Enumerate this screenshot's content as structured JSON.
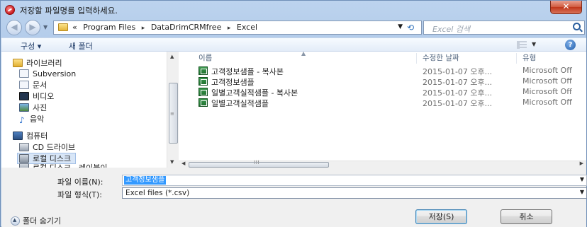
{
  "window": {
    "title": "저장할 파일명를 입력하세요.",
    "close_glyph": "✕"
  },
  "address": {
    "crumbs": [
      "«",
      "Program Files",
      "DataDrimCRMfree",
      "Excel"
    ],
    "separator": "▸",
    "search_placeholder": "Excel 검색"
  },
  "toolbar": {
    "organize": "구성 ▾",
    "new_folder": "새 폴더",
    "help_glyph": "?"
  },
  "nav": {
    "items": [
      {
        "label": "라이브러리",
        "icon": "library-icon"
      },
      {
        "label": "Subversion",
        "icon": "document-icon"
      },
      {
        "label": "문서",
        "icon": "document-icon"
      },
      {
        "label": "비디오",
        "icon": "video-icon"
      },
      {
        "label": "사진",
        "icon": "photo-icon"
      },
      {
        "label": "음악",
        "icon": "music-icon"
      },
      {
        "label": "컴퓨터",
        "icon": "computer-icon"
      },
      {
        "label": "CD 드라이브",
        "icon": "cd-drive-icon"
      },
      {
        "label": "로컬 디스크",
        "icon": "disk-icon"
      },
      {
        "label": "로컬 디스크 - 레이블이",
        "icon": "disk-icon"
      }
    ]
  },
  "columns": {
    "name": "이름",
    "modified": "수정한 날짜",
    "type": "유형"
  },
  "files": [
    {
      "name": "고객정보샘플 - 복사본",
      "modified": "2015-01-07 오후...",
      "type": "Microsoft Off"
    },
    {
      "name": "고객정보샘플",
      "modified": "2015-01-07 오후...",
      "type": "Microsoft Off"
    },
    {
      "name": "일별고객실적샘플 - 복사본",
      "modified": "2015-01-07 오후...",
      "type": "Microsoft Off"
    },
    {
      "name": "일별고객실적샘플",
      "modified": "2015-01-07 오후...",
      "type": "Microsoft Off"
    }
  ],
  "form": {
    "filename_label": "파일 이름(N):",
    "filename_value": "고객정보샘플",
    "filetype_label": "파일 형식(T):",
    "filetype_value": "Excel files (*.csv)",
    "hide_folders": "폴더 숨기기",
    "save_label": "저장(S)",
    "cancel_label": "취소"
  }
}
